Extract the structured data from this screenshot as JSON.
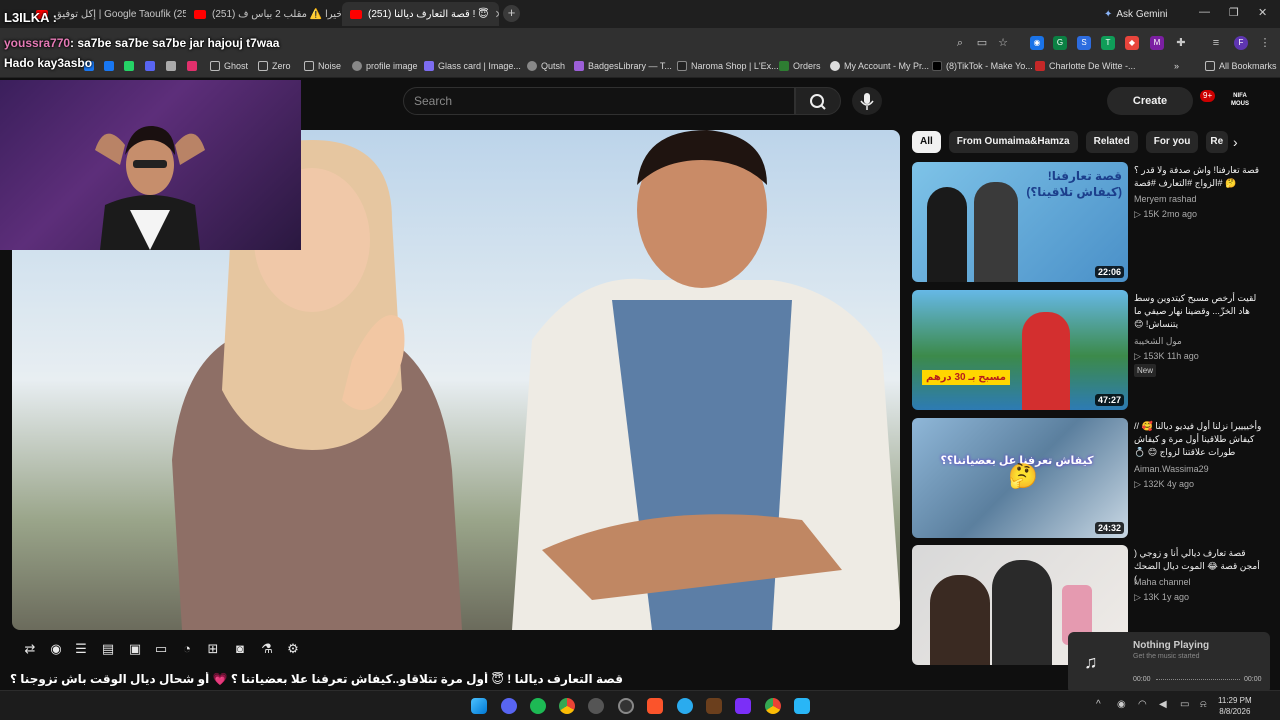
{
  "browser": {
    "tabs": [
      {
        "label": "إكل توفيق | Google Taoufik (255)"
      },
      {
        "label": "(251) و أخيرا ⚠️ مقلب 2 بياس ف..."
      },
      {
        "label": "(251) قصة التعارف ديالنا ! 😇"
      }
    ],
    "ask_gemini": "Ask Gemini"
  },
  "bookmarks": [
    {
      "label": "Ghost"
    },
    {
      "label": "Zero"
    },
    {
      "label": "Noise"
    },
    {
      "label": "profile image"
    },
    {
      "label": "Glass card | Image..."
    },
    {
      "label": "Qutsh"
    },
    {
      "label": "BadgesLibrary — T..."
    },
    {
      "label": "Naroma Shop | L'Ex..."
    },
    {
      "label": "Orders"
    },
    {
      "label": "My Account - My Pr..."
    },
    {
      "label": "(8)TikTok - Make Yo..."
    },
    {
      "label": "Charlotte De Witte -..."
    }
  ],
  "all_bookmarks": "All Bookmarks",
  "youtube": {
    "search_placeholder": "Search",
    "create_label": "Create",
    "notif_count": "9+",
    "channel_logo": "NIFA MOUS"
  },
  "overlay": {
    "line1": "L3ILKA :",
    "user": "youssra770",
    "message": ": sa7be sa7be sa7be jar hajouj t7waa",
    "line3": "Hado kay3asbo"
  },
  "video": {
    "title": "قصة التعارف ديالنا ! 😇 أول مرة تتلاقاو..كيفاش تعرفنا علا بعضياتنا ؟ 💗 أو شحال ديال الوقت باش تزوجنا ؟"
  },
  "chips": [
    {
      "label": "All",
      "active": true
    },
    {
      "label": "From Oumaima&Hamza"
    },
    {
      "label": "Related"
    },
    {
      "label": "For you"
    },
    {
      "label": "Re"
    }
  ],
  "recommendations": [
    {
      "title": "قصة تعارفنا! واش صدفة ولا قدر ؟ 🤔 #الزواج #التعارف #قصة",
      "channel": "Meryem rashad",
      "meta": "15K  2mo ago",
      "duration": "22:06",
      "thumb_text": "قصة تعارفنا! (كيفاش تلاقينا؟)"
    },
    {
      "title": "لقيت أرخص مسبح كيتدوين وسط هاد الخزّ... وقضينا نهار صيفي ما يتنساش! 😊",
      "channel": "مول الشخيبة",
      "meta": "153K  11h ago",
      "badge": "New",
      "duration": "47:27",
      "thumb_text": "مسبح بـ 30 درهم"
    },
    {
      "title": "وأخييييرا نزلنا أول فيديو ديالنا 🥰 // كيفاش طلاقينا أول مرة و كيفاش طورات علاقتنا لزواج 😊 💍",
      "channel": "Aiman.Wassima29",
      "meta": "132K  4y ago",
      "duration": "24:32",
      "thumb_text": "كيفاش تعرفنا عل بعضياتنا؟؟"
    },
    {
      "title": "قصة تعارف ديالي أنا و زوجي ( أمجن قصة 😂 الموت ديال الضحك )",
      "channel": "Maha channel",
      "meta": "13K  1y ago",
      "duration": "",
      "thumb_text": ""
    }
  ],
  "music": {
    "status": "Nothing Playing",
    "subtitle": "Get the music started",
    "time_start": "00:00",
    "time_end": "00:00"
  },
  "taskbar": {
    "time": "11:29 PM",
    "date": "8/8/2026"
  }
}
